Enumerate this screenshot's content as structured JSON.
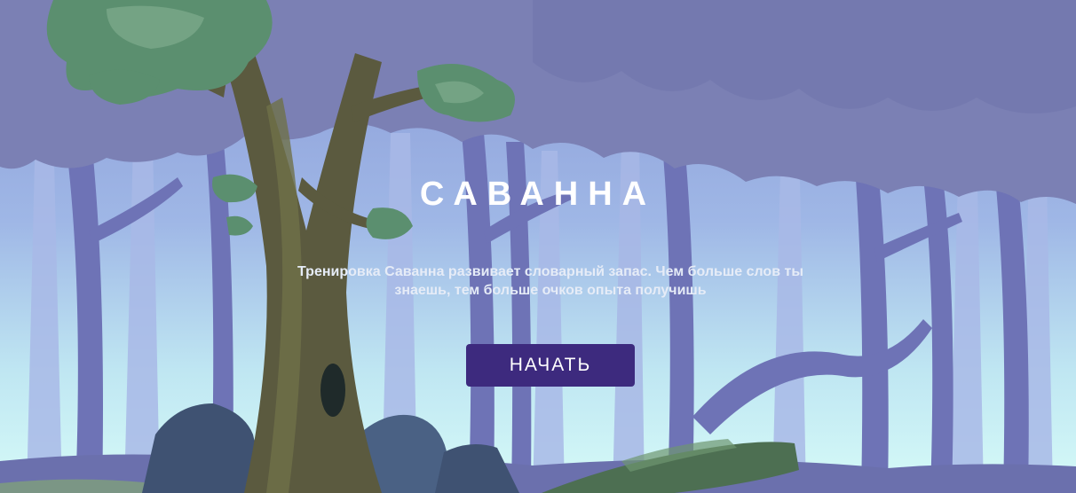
{
  "game": {
    "title": "САВАННА",
    "description": "Тренировка Саванна развивает словарный запас. Чем больше слов ты знаешь, тем больше очков опыта получишь",
    "start_label": "НАЧАТЬ"
  },
  "colors": {
    "button_bg": "#3d2a7e",
    "canopy": "#7a7fb3",
    "far_trees": "#a6b6e6",
    "mid_trees": "#6c72b5",
    "sky_glow": "#d8fbfa",
    "tree_trunk": "#5a5a3e",
    "foliage": "#5a8f6e"
  }
}
